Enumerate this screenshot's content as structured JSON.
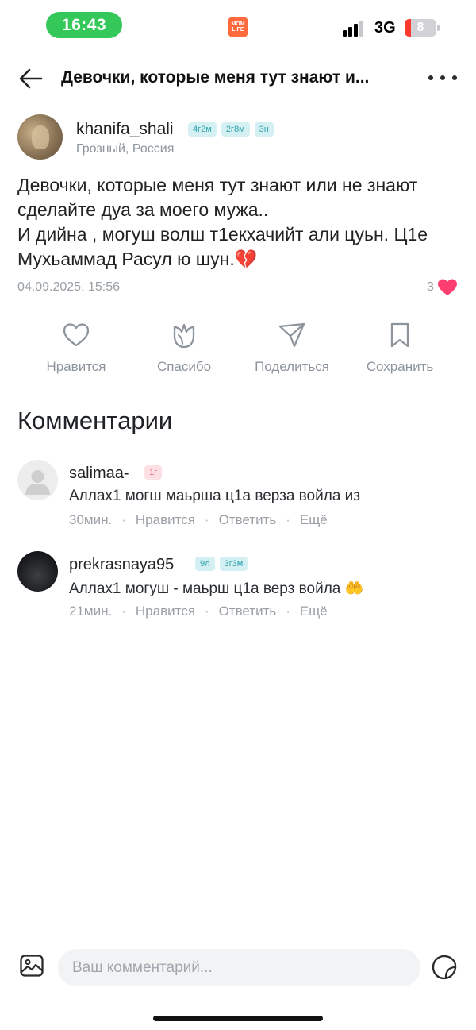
{
  "status_bar": {
    "time": "16:43",
    "app_logo": "MOM LIFE",
    "network": "3G",
    "battery_level": "8",
    "battery_color": "#ff3b30",
    "time_pill_color": "#34c759"
  },
  "header": {
    "back_icon": "arrow-left-icon",
    "title": "Девочки, которые меня тут знают и...",
    "more_icon": "more-horizontal-icon"
  },
  "author": {
    "username": "khanifa_shali",
    "badges": [
      "4г2м",
      "2г8м",
      "3н"
    ],
    "location": "Грозный, Россия"
  },
  "post": {
    "lines": [
      "Девочки, которые меня тут знают или не знают сделайте дуа за моего мужа..",
      "И дийна , могуш волш т1екхачийт али цуьн. Ц1е Мухьаммад Расул ю шун.💔"
    ],
    "date": "04.09.2025, 15:56",
    "likes_count": "3",
    "like_color": "#ff3d6e"
  },
  "actions": [
    {
      "icon": "heart-icon",
      "label": "Нравится"
    },
    {
      "icon": "flower-icon",
      "label": "Спасибо"
    },
    {
      "icon": "send-icon",
      "label": "Поделиться"
    },
    {
      "icon": "bookmark-icon",
      "label": "Сохранить"
    }
  ],
  "comments_section": {
    "title": "Комментарии",
    "items": [
      {
        "username": "salimaa-",
        "badges": [
          {
            "text": "1г",
            "style": "pink"
          }
        ],
        "text": "Аллах1 могш маьрша ц1а верза войла из",
        "time": "30мин.",
        "like": "Нравится",
        "reply": "Ответить",
        "more": "Ещё"
      },
      {
        "username": "prekrasnaya95",
        "badges": [
          {
            "text": "9л",
            "style": "teal"
          },
          {
            "text": "3г3м",
            "style": "teal"
          }
        ],
        "text": "Аллах1  могуш -  маьрш ц1а верз войла 🤲",
        "time": "21мин.",
        "like": "Нравится",
        "reply": "Ответить",
        "more": "Ещё"
      }
    ]
  },
  "input_bar": {
    "photo_icon": "image-icon",
    "placeholder": "Ваш комментарий...",
    "sticker_icon": "sticker-icon"
  }
}
